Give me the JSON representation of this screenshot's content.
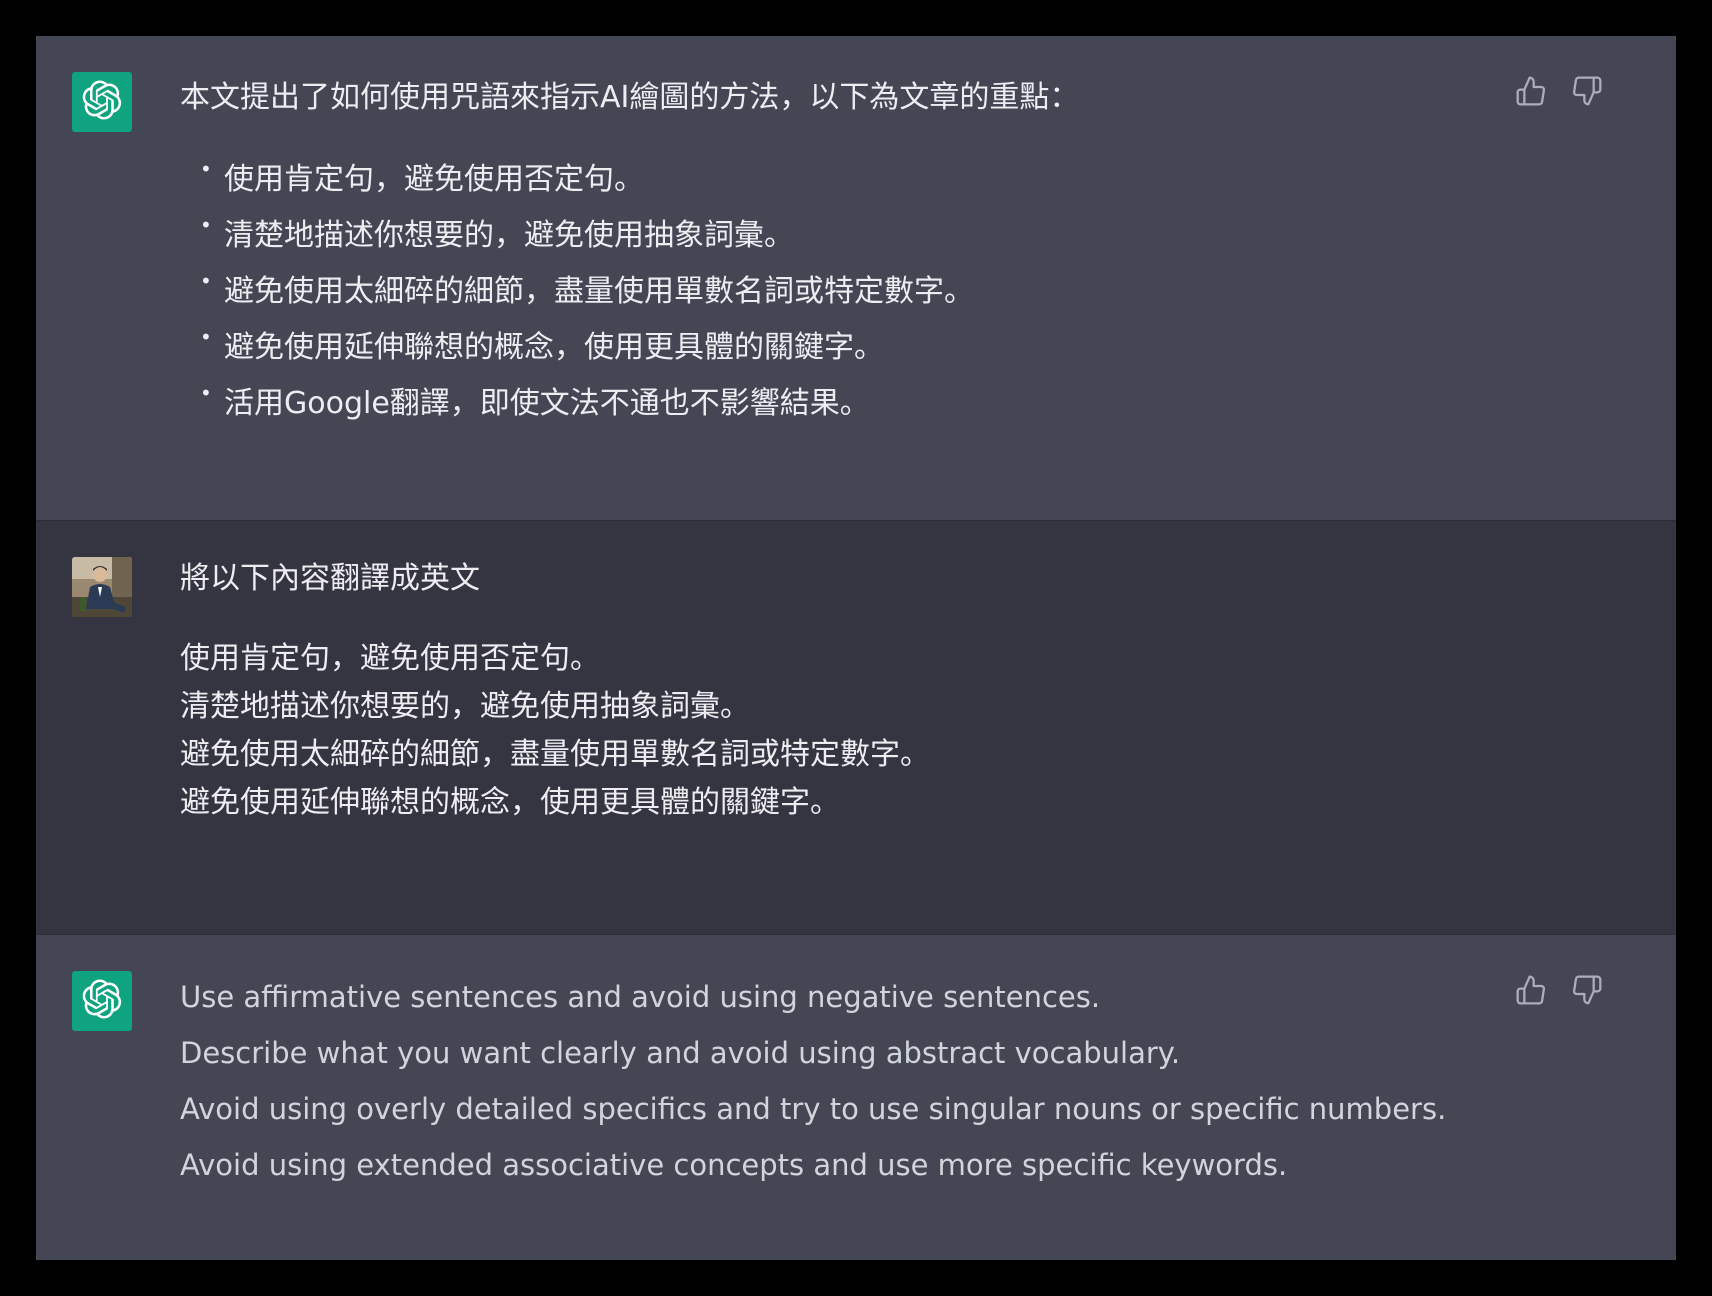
{
  "colors": {
    "assistant_bg": "#444654",
    "user_bg": "#343541",
    "gpt_avatar": "#10a37f",
    "text": "#ececf1",
    "icon": "#acacbe"
  },
  "messages": [
    {
      "role": "assistant",
      "avatar_icon": "openai-logo-icon",
      "intro": "本文提出了如何使用咒語來指示AI繪圖的方法，以下為文章的重點：",
      "bullets": [
        "使用肯定句，避免使用否定句。",
        "清楚地描述你想要的，避免使用抽象詞彙。",
        "避免使用太細碎的細節，盡量使用單數名詞或特定數字。",
        "避免使用延伸聯想的概念，使用更具體的關鍵字。",
        "活用Google翻譯，即使文法不通也不影響結果。"
      ],
      "feedback_icons": [
        "thumbs-up-icon",
        "thumbs-down-icon"
      ]
    },
    {
      "role": "user",
      "avatar_icon": "user-avatar-photo",
      "request": "將以下內容翻譯成英文",
      "lines": [
        "使用肯定句，避免使用否定句。",
        "清楚地描述你想要的，避免使用抽象詞彙。",
        "避免使用太細碎的細節，盡量使用單數名詞或特定數字。",
        "避免使用延伸聯想的概念，使用更具體的關鍵字。"
      ]
    },
    {
      "role": "assistant",
      "avatar_icon": "openai-logo-icon",
      "lines": [
        "Use affirmative sentences and avoid using negative sentences.",
        "Describe what you want clearly and avoid using abstract vocabulary.",
        "Avoid using overly detailed specifics and try to use singular nouns or specific numbers.",
        "Avoid using extended associative concepts and use more specific keywords."
      ],
      "feedback_icons": [
        "thumbs-up-icon",
        "thumbs-down-icon"
      ]
    }
  ]
}
